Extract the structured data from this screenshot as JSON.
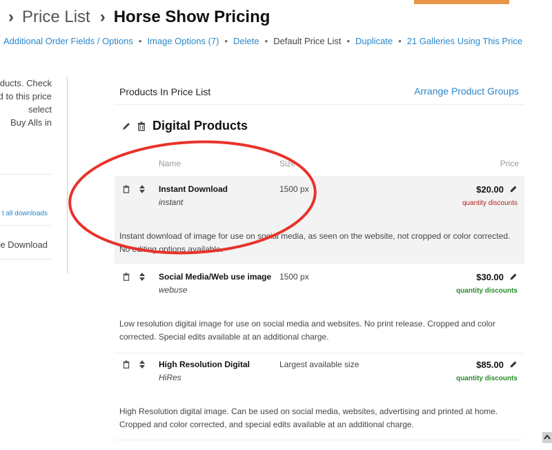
{
  "breadcrumb": {
    "parent": "Price List",
    "current": "Horse Show Pricing"
  },
  "actions": {
    "order_fields": "Additional Order Fields / Options",
    "image_options": "Image Options (7)",
    "delete": "Delete",
    "default": "Default Price List",
    "duplicate": "Duplicate",
    "galleries": "21 Galleries Using This Price"
  },
  "sidebar": {
    "lines": [
      "ducts. Check",
      "d to this price",
      "select",
      "Buy Alls in"
    ],
    "link": "t all downloads",
    "download": "ee Download"
  },
  "main": {
    "title": "Products In Price List",
    "arrange": "Arrange Product Groups",
    "group_title": "Digital Products",
    "columns": {
      "name": "Name",
      "size": "Size",
      "price": "Price"
    },
    "products": [
      {
        "name": "Instant Download",
        "code": "instant",
        "size": "1500 px",
        "price": "$20.00",
        "discounts": "quantity discounts",
        "description": "Instant download of image for use on social media, as seen on the website, not cropped or color corrected. No editing options available."
      },
      {
        "name": "Social Media/Web use image",
        "code": "webuse",
        "size": "1500 px",
        "price": "$30.00",
        "discounts": "quantity discounts",
        "description": "Low resolution digital image for use on social media and websites. No print release. Cropped and color corrected. Special edits available at an additional charge."
      },
      {
        "name": "High Resolution Digital",
        "code": "HiRes",
        "size": "Largest available size",
        "price": "$85.00",
        "discounts": "quantity discounts",
        "description": "High Resolution digital image. Can be used on social media, websites, advertising and printed at home. Cropped and color corrected, and special edits available at an additional charge."
      }
    ]
  },
  "colors": {
    "link": "#2a86c7",
    "discount_red": "#b22222",
    "discount_green": "#2a8a2a",
    "annotation": "#e8332a",
    "top_button": "#e8954a"
  },
  "icons": [
    "pencil-icon",
    "trash-icon",
    "sort-arrows-icon",
    "chevron-right-icon",
    "scroll-up-icon"
  ]
}
